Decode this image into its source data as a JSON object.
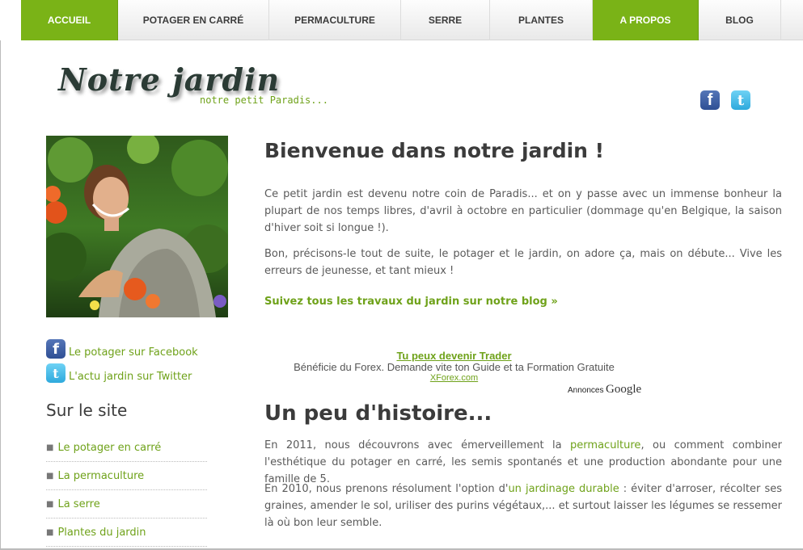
{
  "nav": {
    "items": [
      {
        "label": "ACCUEIL",
        "active": true
      },
      {
        "label": "POTAGER EN CARRÉ",
        "active": false
      },
      {
        "label": "PERMACULTURE",
        "active": false
      },
      {
        "label": "SERRE",
        "active": false
      },
      {
        "label": "PLANTES",
        "active": false
      },
      {
        "label": "A PROPOS",
        "active": true
      },
      {
        "label": "BLOG",
        "active": false
      }
    ]
  },
  "header": {
    "logo_title": "Notre jardin",
    "logo_tagline": "notre petit Paradis...",
    "social_icons": [
      "facebook-icon",
      "twitter-icon"
    ]
  },
  "sidebar": {
    "facebook_link": "Le potager sur Facebook",
    "twitter_link": "L'actu jardin sur Twitter",
    "title": "Sur le site",
    "items": [
      {
        "label": "Le potager en carré"
      },
      {
        "label": "La permaculture"
      },
      {
        "label": "La serre"
      },
      {
        "label": "Plantes du jardin"
      }
    ]
  },
  "main": {
    "welcome_title": "Bienvenue dans notre jardin !",
    "intro_p1": "Ce petit jardin est devenu notre coin de Paradis... et on y passe avec un immense bonheur la plupart de nos temps libres, d'avril à octobre en particulier (dommage qu'en Belgique, la saison d'hiver soit si longue !).",
    "intro_p2": "Bon, précisons-le tout de suite, le potager et le jardin, on adore ça, mais on débute... Vive les erreurs de jeunesse, et tant mieux !",
    "blog_link": "Suivez tous les travaux du jardin sur notre blog »",
    "history_title": "Un peu d'histoire...",
    "history_p1": {
      "before": "En 2011, nous découvrons avec émerveillement la ",
      "link": "permaculture",
      "after": ", ou comment combiner l'esthétique du potager en carré, les semis spontanés et une production abondante pour une famille de 5."
    },
    "history_p2": {
      "before": "En 2010, nous prenons résolument l'option d'",
      "link": "un jardinage durable",
      "after": " : éviter d'arroser, récolter ses graines, amender le sol, uriliser des purins végétaux,... et surtout laisser les légumes se ressemer là où bon leur semble."
    }
  },
  "ad": {
    "title": "Tu peux devenir Trader",
    "description": "Bénéficie du Forex. Demande vite ton Guide et ta Formation Gratuite",
    "url": "XForex.com",
    "annonces": "Annonces",
    "google": "Google"
  },
  "colors": {
    "accent": "#7ab317",
    "link": "#6fa21a",
    "text": "#5a5a5a",
    "facebook": "#3b5998",
    "twitter": "#33b5e5"
  }
}
